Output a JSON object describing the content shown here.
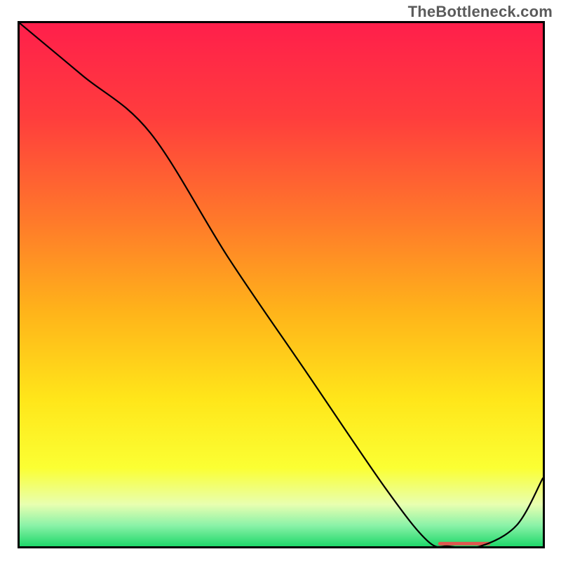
{
  "watermark": "TheBottleneck.com",
  "chart_data": {
    "type": "line",
    "title": "",
    "xlabel": "",
    "ylabel": "",
    "xlim": [
      0,
      100
    ],
    "ylim": [
      0,
      100
    ],
    "series": [
      {
        "name": "curve",
        "x": [
          0,
          12,
          25,
          40,
          55,
          70,
          78,
          82,
          88,
          95,
          100
        ],
        "y": [
          100,
          90,
          79,
          55,
          33,
          11,
          1,
          0,
          0,
          4,
          13
        ]
      }
    ],
    "marker_band": {
      "x_start": 80,
      "x_end": 90,
      "y": 0.5
    },
    "gradient_stops": [
      {
        "offset": 0,
        "color": "#ff1f4b"
      },
      {
        "offset": 18,
        "color": "#ff3d3d"
      },
      {
        "offset": 38,
        "color": "#ff7a2a"
      },
      {
        "offset": 55,
        "color": "#ffb31a"
      },
      {
        "offset": 72,
        "color": "#ffe61a"
      },
      {
        "offset": 85,
        "color": "#fbff33"
      },
      {
        "offset": 92,
        "color": "#e8ffb0"
      },
      {
        "offset": 96,
        "color": "#8bf2a8"
      },
      {
        "offset": 100,
        "color": "#1fd86a"
      }
    ]
  }
}
